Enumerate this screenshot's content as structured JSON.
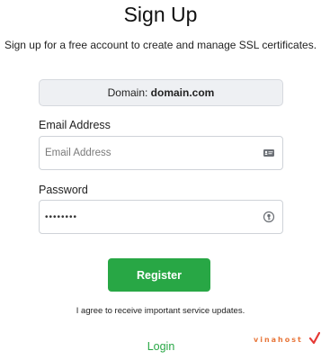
{
  "page": {
    "title": "Sign Up",
    "subtitle": "Sign up for a free account to create and manage SSL certificates."
  },
  "domain_box": {
    "label": "Domain: ",
    "value": "domain.com"
  },
  "email": {
    "label": "Email Address",
    "placeholder": "Email Address",
    "value": "",
    "icon": "contact-card-icon"
  },
  "password": {
    "label": "Password",
    "value": "••••••••",
    "icon": "password-manager-key-icon"
  },
  "register_button": {
    "label": "Register"
  },
  "agree_text": "I agree to receive important service updates.",
  "login_link": "Login",
  "watermark": {
    "text": "vinahost"
  },
  "colors": {
    "accent": "#28a745",
    "domain_box_bg": "#eef0f3",
    "watermark": "#e8763a"
  }
}
